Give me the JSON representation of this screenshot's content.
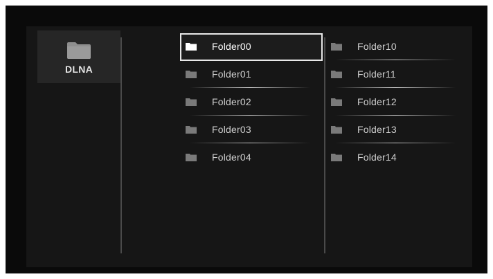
{
  "source": {
    "label": "DLNA",
    "icon": "folder-icon"
  },
  "columns": [
    {
      "items": [
        {
          "label": "Folder00",
          "icon": "folder-icon",
          "focused": true
        },
        {
          "label": "Folder01",
          "icon": "folder-icon",
          "focused": false
        },
        {
          "label": "Folder02",
          "icon": "folder-icon",
          "focused": false
        },
        {
          "label": "Folder03",
          "icon": "folder-icon",
          "focused": false
        },
        {
          "label": "Folder04",
          "icon": "folder-icon",
          "focused": false
        }
      ]
    },
    {
      "items": [
        {
          "label": "Folder10",
          "icon": "folder-icon",
          "focused": false
        },
        {
          "label": "Folder11",
          "icon": "folder-icon",
          "focused": false
        },
        {
          "label": "Folder12",
          "icon": "folder-icon",
          "focused": false
        },
        {
          "label": "Folder13",
          "icon": "folder-icon",
          "focused": false
        },
        {
          "label": "Folder14",
          "icon": "folder-icon",
          "focused": false
        }
      ]
    }
  ],
  "colors": {
    "background": "#0a0a0a",
    "panel": "#161616",
    "source_tile": "#262626",
    "text": "#cfcfcf",
    "focus_border": "#e8e8e8",
    "folder_icon": "#8a8a8a",
    "folder_icon_focused": "#ffffff"
  }
}
